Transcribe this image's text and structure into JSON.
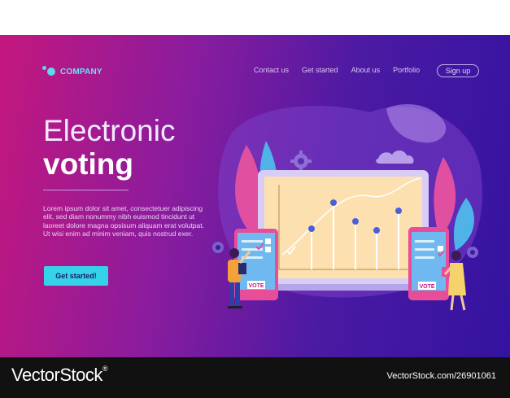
{
  "brand": {
    "name": "COMPANY",
    "accent": "#35d3ea"
  },
  "nav": {
    "items": [
      "Contact us",
      "Get started",
      "About us",
      "Portfolio"
    ],
    "signup": "Sign up"
  },
  "hero": {
    "title_line1": "Electronic",
    "title_line2": "voting",
    "body": "Lorem ipsum dolor sit amet, consectetuer adipiscing elit, sed diam nonummy nibh euismod tincidunt ut laoreet dolore magna opsisum aliquam erat volutpat. Ut wisi enim ad minim veniam, quis nostrud exer.",
    "cta": "Get started!"
  },
  "illustration": {
    "vote_label_left": "VOTE",
    "vote_label_right": "VOTE",
    "icons": [
      "gear-icon",
      "checkmark-icon",
      "laptop-icon",
      "phone-icon"
    ]
  },
  "watermark": {
    "left": "VectorStock",
    "registered": "®",
    "right": "VectorStock.com/26901061"
  }
}
